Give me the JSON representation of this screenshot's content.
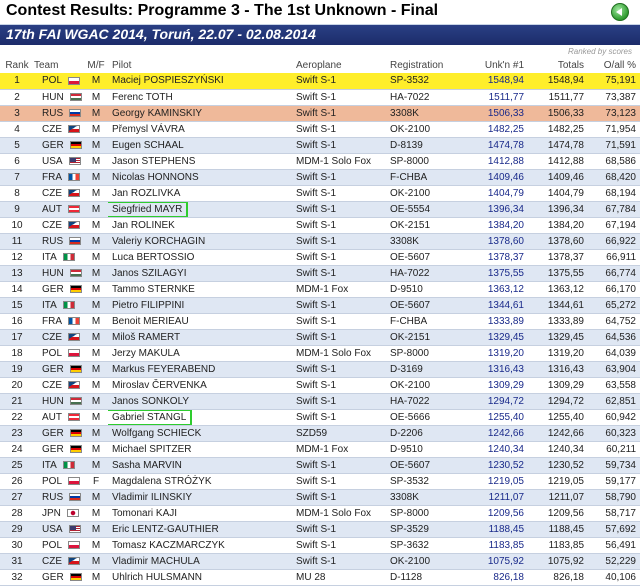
{
  "header": {
    "title": "Contest Results: Programme 3 - The 1st Unknown - Final",
    "subtitle": "17th FAI WGAC 2014, Toruń, 22.07 - 02.08.2014",
    "ranked_note": "Ranked by scores"
  },
  "columns": {
    "rank": "Rank",
    "team": "Team",
    "mf": "M/F",
    "pilot": "Pilot",
    "aeroplane": "Aeroplane",
    "registration": "Registration",
    "unknown": "Unk'n #1",
    "totals": "Totals",
    "overall": "O/all %"
  },
  "rows": [
    {
      "rank": "1",
      "team": "POL",
      "mf": "M",
      "pilot": "Maciej POSPIESZYŃSKI",
      "aeroplane": "Swift S-1",
      "registration": "SP-3532",
      "unknown": "1548,94",
      "totals": "1548,94",
      "overall": "75,191",
      "style": "gold"
    },
    {
      "rank": "2",
      "team": "HUN",
      "mf": "M",
      "pilot": "Ferenc TOTH",
      "aeroplane": "Swift S-1",
      "registration": "HA-7022",
      "unknown": "1511,77",
      "totals": "1511,77",
      "overall": "73,387",
      "style": ""
    },
    {
      "rank": "3",
      "team": "RUS",
      "mf": "M",
      "pilot": "Georgy KAMINSKIY",
      "aeroplane": "Swift S-1",
      "registration": "3308K",
      "unknown": "1506,33",
      "totals": "1506,33",
      "overall": "73,123",
      "style": "bronze"
    },
    {
      "rank": "4",
      "team": "CZE",
      "mf": "M",
      "pilot": "Přemysl VÁVRA",
      "aeroplane": "Swift S-1",
      "registration": "OK-2100",
      "unknown": "1482,25",
      "totals": "1482,25",
      "overall": "71,954",
      "style": ""
    },
    {
      "rank": "5",
      "team": "GER",
      "mf": "M",
      "pilot": "Eugen SCHAAL",
      "aeroplane": "Swift S-1",
      "registration": "D-8139",
      "unknown": "1474,78",
      "totals": "1474,78",
      "overall": "71,591",
      "style": "alt"
    },
    {
      "rank": "6",
      "team": "USA",
      "mf": "M",
      "pilot": "Jason STEPHENS",
      "aeroplane": "MDM-1 Solo Fox",
      "registration": "SP-8000",
      "unknown": "1412,88",
      "totals": "1412,88",
      "overall": "68,586",
      "style": ""
    },
    {
      "rank": "7",
      "team": "FRA",
      "mf": "M",
      "pilot": "Nicolas HONNONS",
      "aeroplane": "Swift S-1",
      "registration": "F-CHBA",
      "unknown": "1409,46",
      "totals": "1409,46",
      "overall": "68,420",
      "style": "alt"
    },
    {
      "rank": "8",
      "team": "CZE",
      "mf": "M",
      "pilot": "Jan ROZLIVKA",
      "aeroplane": "Swift S-1",
      "registration": "OK-2100",
      "unknown": "1404,79",
      "totals": "1404,79",
      "overall": "68,194",
      "style": ""
    },
    {
      "rank": "9",
      "team": "AUT",
      "mf": "M",
      "pilot": "Siegfried MAYR",
      "aeroplane": "Swift S-1",
      "registration": "OE-5554",
      "unknown": "1396,34",
      "totals": "1396,34",
      "overall": "67,784",
      "style": "alt",
      "highlight": true
    },
    {
      "rank": "10",
      "team": "CZE",
      "mf": "M",
      "pilot": "Jan ROLINEK",
      "aeroplane": "Swift S-1",
      "registration": "OK-2151",
      "unknown": "1384,20",
      "totals": "1384,20",
      "overall": "67,194",
      "style": ""
    },
    {
      "rank": "11",
      "team": "RUS",
      "mf": "M",
      "pilot": "Valeriy KORCHAGIN",
      "aeroplane": "Swift S-1",
      "registration": "3308K",
      "unknown": "1378,60",
      "totals": "1378,60",
      "overall": "66,922",
      "style": "alt"
    },
    {
      "rank": "12",
      "team": "ITA",
      "mf": "M",
      "pilot": "Luca BERTOSSIO",
      "aeroplane": "Swift S-1",
      "registration": "OE-5607",
      "unknown": "1378,37",
      "totals": "1378,37",
      "overall": "66,911",
      "style": ""
    },
    {
      "rank": "13",
      "team": "HUN",
      "mf": "M",
      "pilot": "Janos SZILAGYI",
      "aeroplane": "Swift S-1",
      "registration": "HA-7022",
      "unknown": "1375,55",
      "totals": "1375,55",
      "overall": "66,774",
      "style": "alt"
    },
    {
      "rank": "14",
      "team": "GER",
      "mf": "M",
      "pilot": "Tammo STERNKE",
      "aeroplane": "MDM-1 Fox",
      "registration": "D-9510",
      "unknown": "1363,12",
      "totals": "1363,12",
      "overall": "66,170",
      "style": ""
    },
    {
      "rank": "15",
      "team": "ITA",
      "mf": "M",
      "pilot": "Pietro FILIPPINI",
      "aeroplane": "Swift S-1",
      "registration": "OE-5607",
      "unknown": "1344,61",
      "totals": "1344,61",
      "overall": "65,272",
      "style": "alt"
    },
    {
      "rank": "16",
      "team": "FRA",
      "mf": "M",
      "pilot": "Benoit MERIEAU",
      "aeroplane": "Swift S-1",
      "registration": "F-CHBA",
      "unknown": "1333,89",
      "totals": "1333,89",
      "overall": "64,752",
      "style": ""
    },
    {
      "rank": "17",
      "team": "CZE",
      "mf": "M",
      "pilot": "Miloš RAMERT",
      "aeroplane": "Swift S-1",
      "registration": "OK-2151",
      "unknown": "1329,45",
      "totals": "1329,45",
      "overall": "64,536",
      "style": "alt"
    },
    {
      "rank": "18",
      "team": "POL",
      "mf": "M",
      "pilot": "Jerzy MAKULA",
      "aeroplane": "MDM-1 Solo Fox",
      "registration": "SP-8000",
      "unknown": "1319,20",
      "totals": "1319,20",
      "overall": "64,039",
      "style": ""
    },
    {
      "rank": "19",
      "team": "GER",
      "mf": "M",
      "pilot": "Markus FEYERABEND",
      "aeroplane": "Swift S-1",
      "registration": "D-3169",
      "unknown": "1316,43",
      "totals": "1316,43",
      "overall": "63,904",
      "style": "alt"
    },
    {
      "rank": "20",
      "team": "CZE",
      "mf": "M",
      "pilot": "Miroslav ČERVENKA",
      "aeroplane": "Swift S-1",
      "registration": "OK-2100",
      "unknown": "1309,29",
      "totals": "1309,29",
      "overall": "63,558",
      "style": ""
    },
    {
      "rank": "21",
      "team": "HUN",
      "mf": "M",
      "pilot": "Janos SONKOLY",
      "aeroplane": "Swift S-1",
      "registration": "HA-7022",
      "unknown": "1294,72",
      "totals": "1294,72",
      "overall": "62,851",
      "style": "alt"
    },
    {
      "rank": "22",
      "team": "AUT",
      "mf": "M",
      "pilot": "Gabriel STANGL",
      "aeroplane": "Swift S-1",
      "registration": "OE-5666",
      "unknown": "1255,40",
      "totals": "1255,40",
      "overall": "60,942",
      "style": "",
      "highlight": true
    },
    {
      "rank": "23",
      "team": "GER",
      "mf": "M",
      "pilot": "Wolfgang SCHIECK",
      "aeroplane": "SZD59",
      "registration": "D-2206",
      "unknown": "1242,66",
      "totals": "1242,66",
      "overall": "60,323",
      "style": "alt"
    },
    {
      "rank": "24",
      "team": "GER",
      "mf": "M",
      "pilot": "Michael SPITZER",
      "aeroplane": "MDM-1 Fox",
      "registration": "D-9510",
      "unknown": "1240,34",
      "totals": "1240,34",
      "overall": "60,211",
      "style": ""
    },
    {
      "rank": "25",
      "team": "ITA",
      "mf": "M",
      "pilot": "Sasha MARVIN",
      "aeroplane": "Swift S-1",
      "registration": "OE-5607",
      "unknown": "1230,52",
      "totals": "1230,52",
      "overall": "59,734",
      "style": "alt"
    },
    {
      "rank": "26",
      "team": "POL",
      "mf": "F",
      "pilot": "Magdalena STRÓŻYK",
      "aeroplane": "Swift S-1",
      "registration": "SP-3532",
      "unknown": "1219,05",
      "totals": "1219,05",
      "overall": "59,177",
      "style": ""
    },
    {
      "rank": "27",
      "team": "RUS",
      "mf": "M",
      "pilot": "Vladimir ILINSKIY",
      "aeroplane": "Swift S-1",
      "registration": "3308K",
      "unknown": "1211,07",
      "totals": "1211,07",
      "overall": "58,790",
      "style": "alt"
    },
    {
      "rank": "28",
      "team": "JPN",
      "mf": "M",
      "pilot": "Tomonari KAJI",
      "aeroplane": "MDM-1 Solo Fox",
      "registration": "SP-8000",
      "unknown": "1209,56",
      "totals": "1209,56",
      "overall": "58,717",
      "style": ""
    },
    {
      "rank": "29",
      "team": "USA",
      "mf": "M",
      "pilot": "Eric LENTZ-GAUTHIER",
      "aeroplane": "Swift S-1",
      "registration": "SP-3529",
      "unknown": "1188,45",
      "totals": "1188,45",
      "overall": "57,692",
      "style": "alt"
    },
    {
      "rank": "30",
      "team": "POL",
      "mf": "M",
      "pilot": "Tomasz KACZMARCZYK",
      "aeroplane": "Swift S-1",
      "registration": "SP-3632",
      "unknown": "1183,85",
      "totals": "1183,85",
      "overall": "56,491",
      "style": ""
    },
    {
      "rank": "31",
      "team": "CZE",
      "mf": "M",
      "pilot": "Vladimir MACHULA",
      "aeroplane": "Swift S-1",
      "registration": "OK-2100",
      "unknown": "1075,92",
      "totals": "1075,92",
      "overall": "52,229",
      "style": "alt"
    },
    {
      "rank": "32",
      "team": "GER",
      "mf": "M",
      "pilot": "Uhlrich HULSMANN",
      "aeroplane": "MU 28",
      "registration": "D-1128",
      "unknown": "826,18",
      "totals": "826,18",
      "overall": "40,106",
      "style": ""
    }
  ]
}
